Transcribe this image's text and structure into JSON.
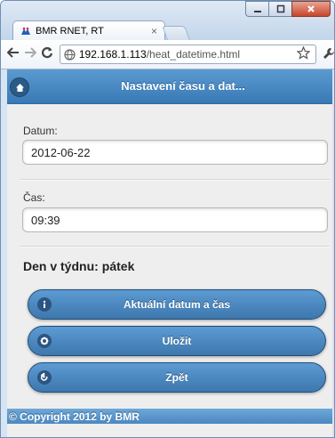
{
  "browser": {
    "tab_title": "BMR RNET, RT",
    "tab_close": "×",
    "url_host": "192.168.1.113",
    "url_path": "/heat_datetime.html"
  },
  "page": {
    "header_title": "Nastavení času a dat...",
    "date_label": "Datum:",
    "date_value": "2012-06-22",
    "time_label": "Čas:",
    "time_value": "09:39",
    "weekday_label": "Den v týdnu:",
    "weekday_value": "pátek",
    "buttons": {
      "current": "Aktuální datum a čas",
      "save": "Uložit",
      "back": "Zpět"
    },
    "footer": "© Copyright 2012 by BMR"
  },
  "colors": {
    "header": "#3979b5",
    "button": "#4b88c0",
    "background": "#eeeeee"
  }
}
